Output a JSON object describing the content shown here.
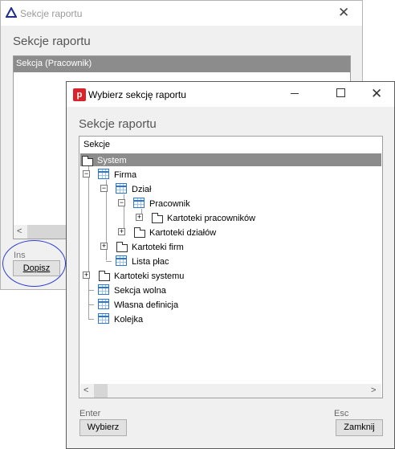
{
  "background_window": {
    "title": "Sekcje raportu",
    "close_glyph": "✕",
    "heading": "Sekcje raportu",
    "list_header": "Sekcja (Pracownik)",
    "scroll_left": "<",
    "shortcut": "Ins",
    "add_button": "Dopisz"
  },
  "dialog": {
    "title": "Wybierz sekcję raportu",
    "app_icon_letter": "p",
    "close_glyph": "✕",
    "heading": "Sekcje raportu",
    "tree_header": "Sekcje",
    "tree": {
      "system": "System",
      "firma": "Firma",
      "dzial": "Dział",
      "pracownik": "Pracownik",
      "kartoteki_pracownikow": "Kartoteki pracowników",
      "kartoteki_dzialow": "Kartoteki działów",
      "kartoteki_firm": "Kartoteki firm",
      "lista_plac": "Lista płac",
      "kartoteki_systemu": "Kartoteki systemu",
      "sekcja_wolna": "Sekcja wolna",
      "wlasna_definicja": "Własna definicja",
      "kolejka": "Kolejka"
    },
    "scroll_left": "<",
    "scroll_right": ">",
    "enter_label": "Enter",
    "select_button": "Wybierz",
    "esc_label": "Esc",
    "close_button": "Zamknij"
  },
  "colors": {
    "selection": "#8c8c8c",
    "annotation_circle": "#2c3ed8",
    "app_icon": "#d8232a",
    "table_icon": "#2a76d2"
  },
  "icons": [
    "triangle-app-icon",
    "folder-icon",
    "table-icon",
    "expand-icon",
    "collapse-icon",
    "close-icon",
    "minimize-icon",
    "maximize-icon"
  ]
}
